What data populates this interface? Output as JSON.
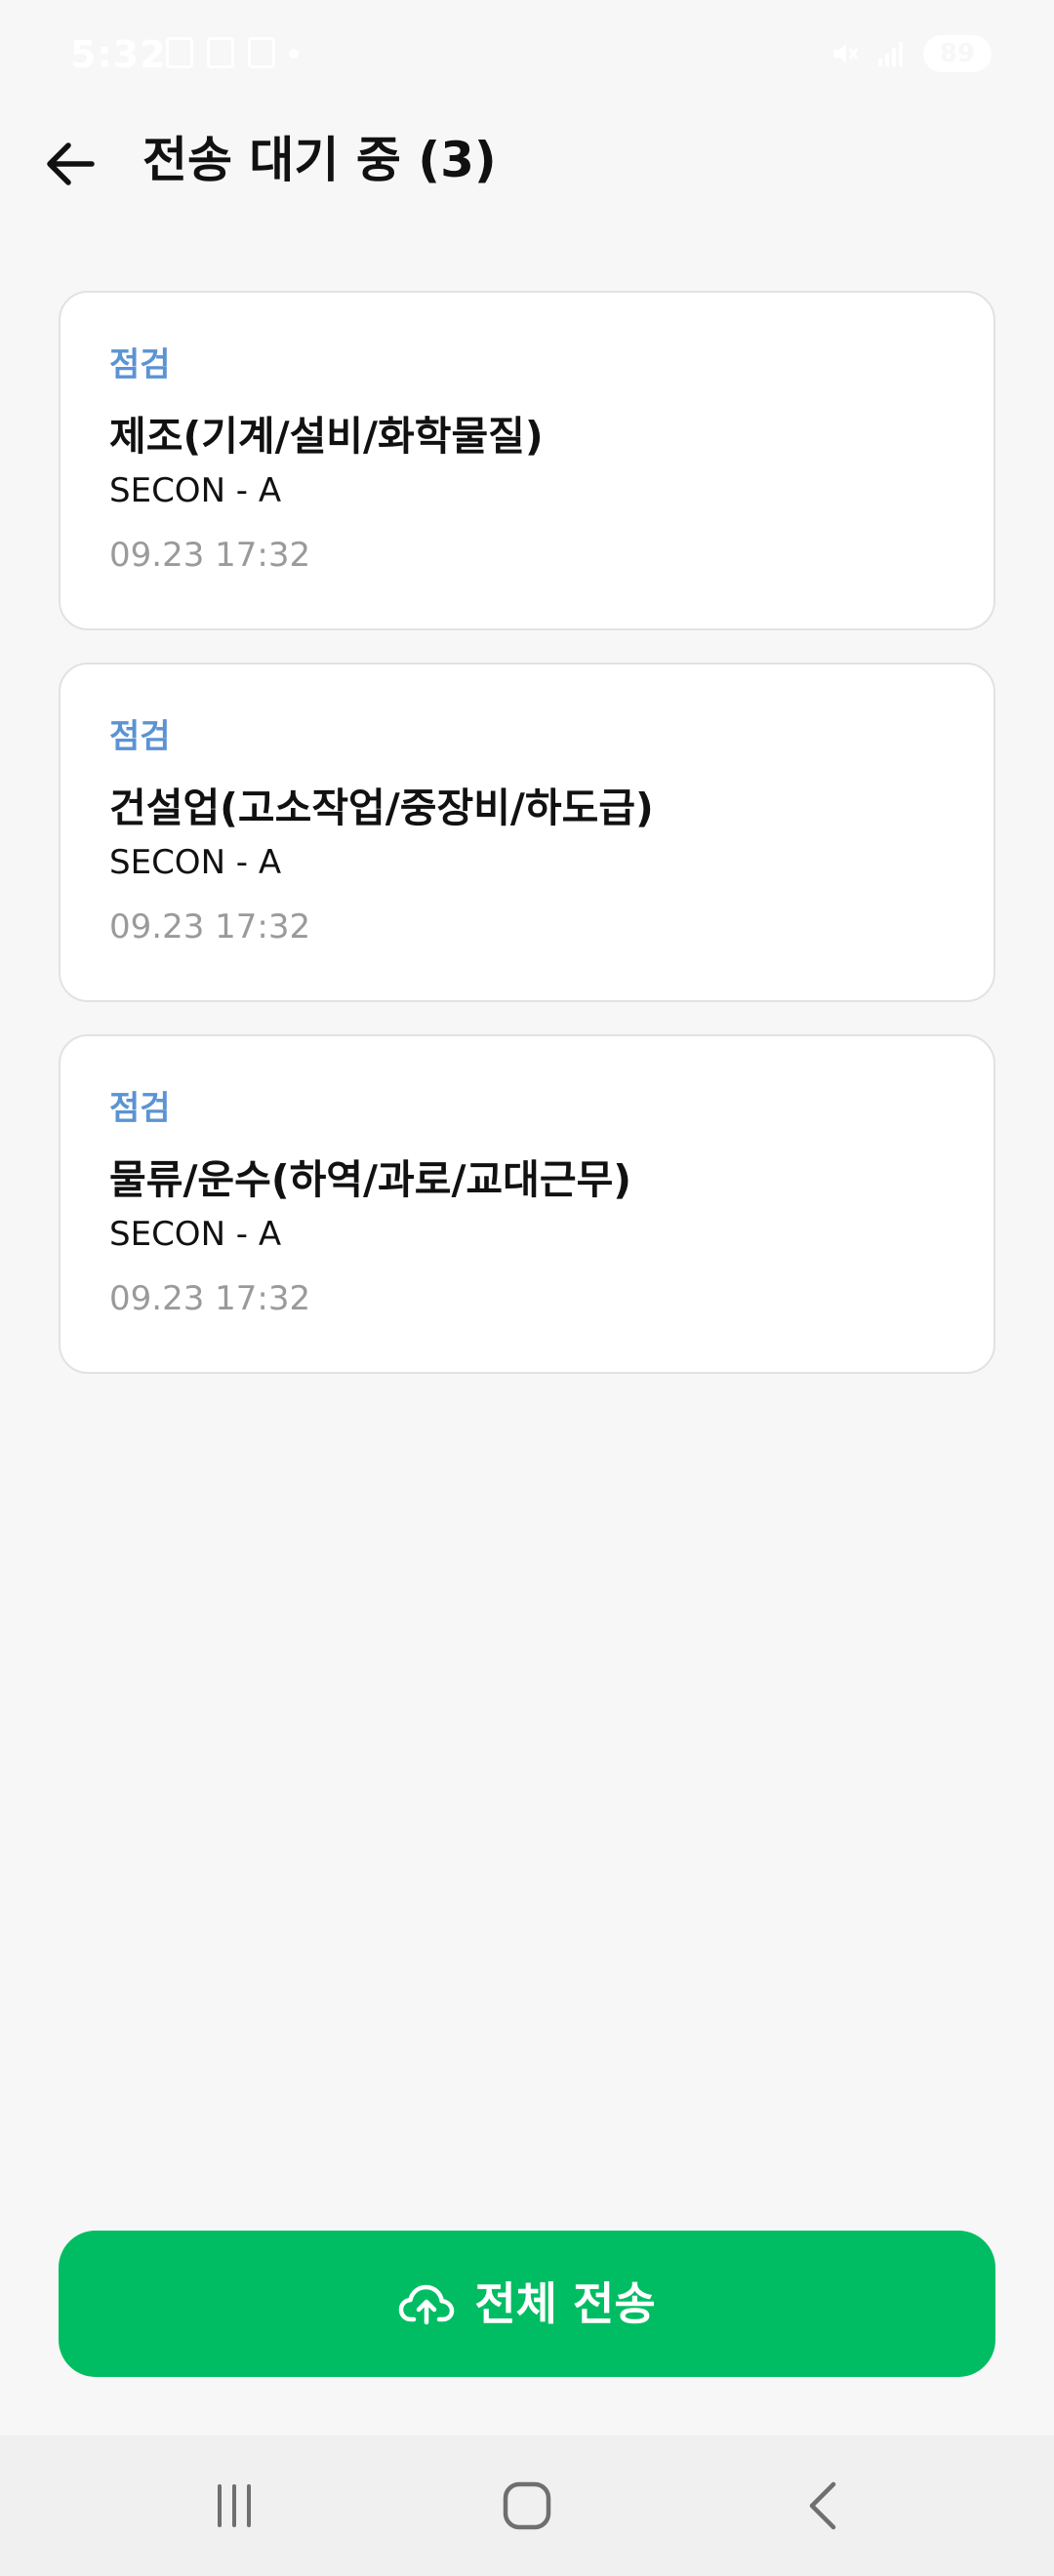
{
  "status_bar": {
    "time": "5:32",
    "battery": "89"
  },
  "header": {
    "title": "전송 대기 중 (3)"
  },
  "items": [
    {
      "category": "점검",
      "title": "제조(기계/설비/화학물질)",
      "subtitle": "SECON - A",
      "time": "09.23 17:32"
    },
    {
      "category": "점검",
      "title": "건설업(고소작업/중장비/하도급)",
      "subtitle": "SECON - A",
      "time": "09.23 17:32"
    },
    {
      "category": "점검",
      "title": "물류/운수(하역/과로/교대근무)",
      "subtitle": "SECON - A",
      "time": "09.23 17:32"
    }
  ],
  "actions": {
    "send_all_label": "전체 전송"
  },
  "colors": {
    "accent_green": "#00bd63",
    "category_blue": "#5b93d3",
    "time_gray": "#9a9a9a",
    "background": "#f7f7f7"
  },
  "icons": {
    "back": "arrow-left-icon",
    "upload": "cloud-upload-icon",
    "nav_recents": "recents-icon",
    "nav_home": "home-icon",
    "nav_back": "chevron-left-icon"
  }
}
